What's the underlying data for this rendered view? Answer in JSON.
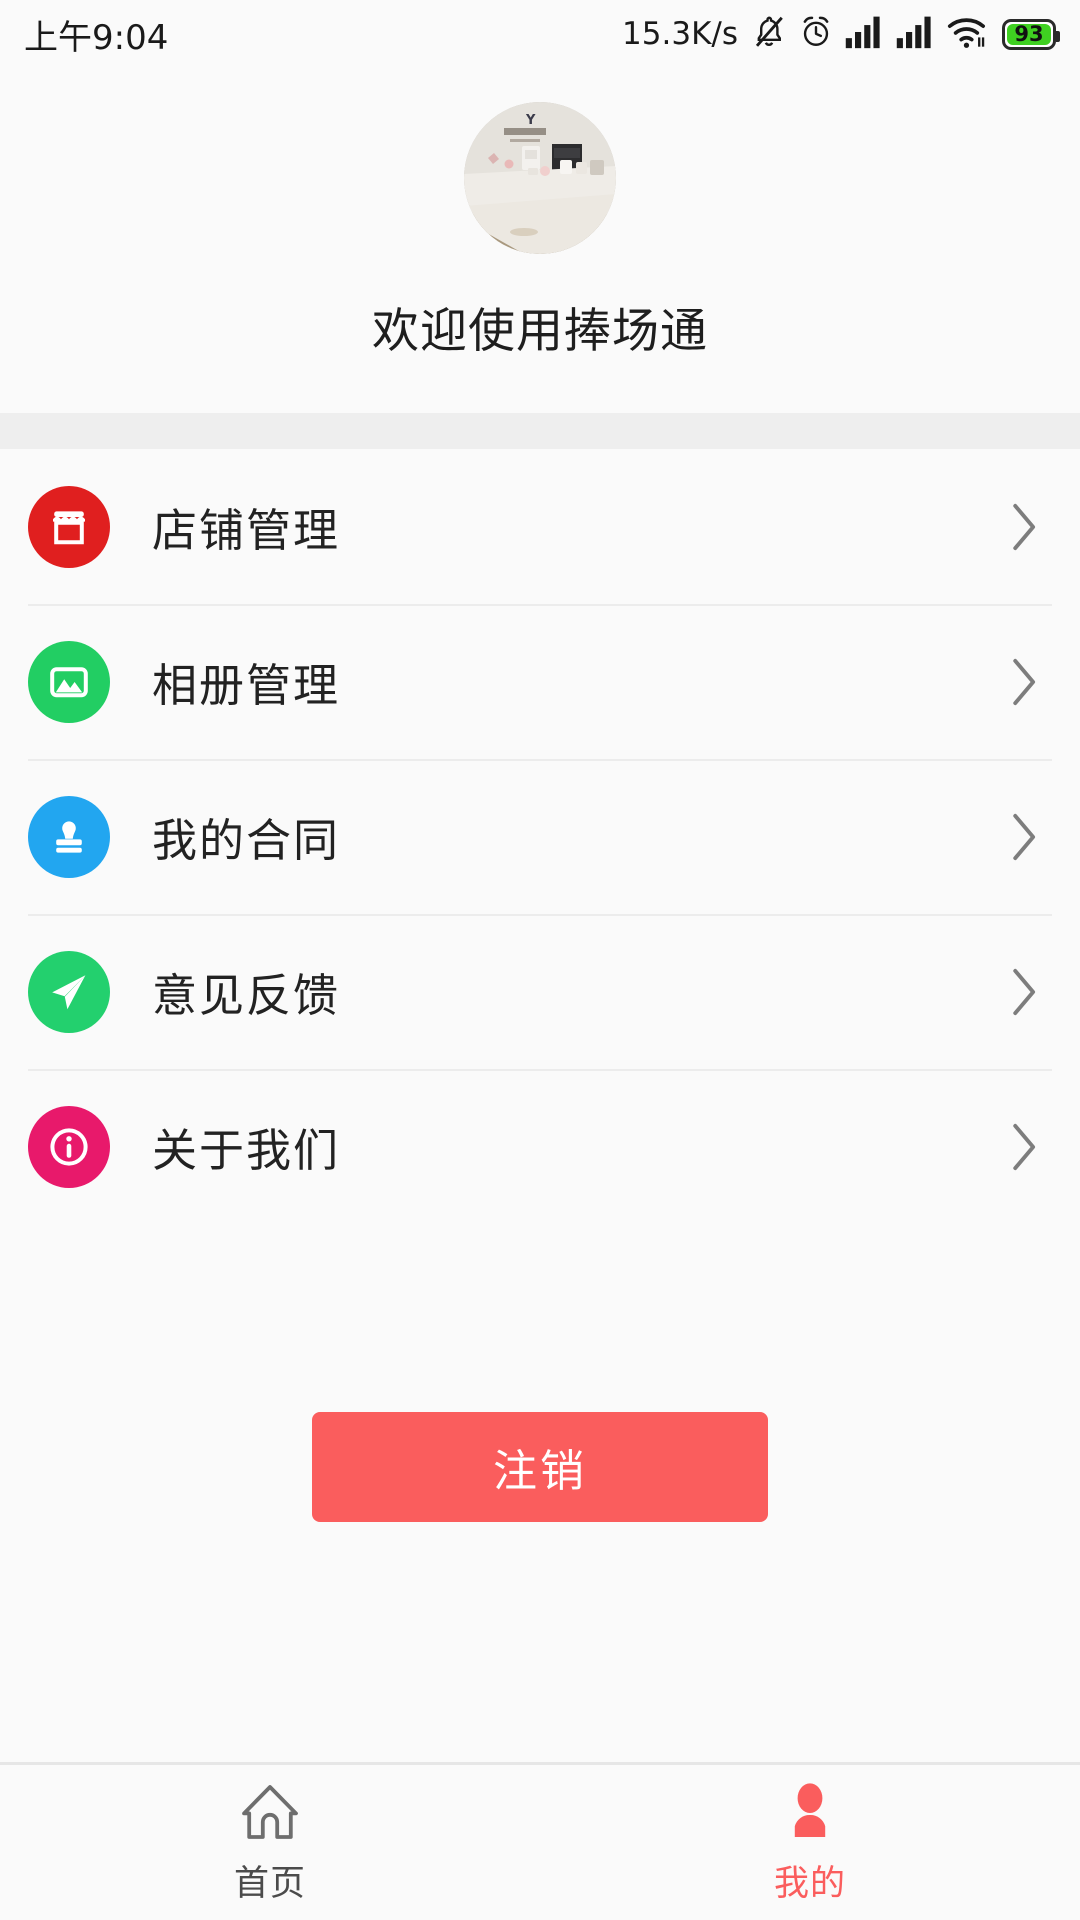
{
  "status_bar": {
    "time": "上午9:04",
    "net_speed": "15.3K/s",
    "battery_level": "93",
    "icons": [
      "bell-muted-icon",
      "alarm-clock-icon",
      "signal-bars-icon",
      "signal-bars-icon",
      "wifi-icon",
      "battery-icon"
    ]
  },
  "profile": {
    "avatar_alt": "店铺照片",
    "welcome_text": "欢迎使用捧场通"
  },
  "menu": {
    "items": [
      {
        "label": "店铺管理",
        "icon": "store-icon",
        "color": "#e01f1f"
      },
      {
        "label": "相册管理",
        "icon": "photo-icon",
        "color": "#22ce63"
      },
      {
        "label": "我的合同",
        "icon": "stamp-icon",
        "color": "#22a6f0"
      },
      {
        "label": "意见反馈",
        "icon": "send-icon",
        "color": "#23d06e"
      },
      {
        "label": "关于我们",
        "icon": "info-icon",
        "color": "#e8196b"
      }
    ],
    "chevron_icon": "chevron-right-icon"
  },
  "logout": {
    "label": "注销",
    "color": "#fa5d5d"
  },
  "tabbar": {
    "tabs": [
      {
        "label": "首页",
        "icon": "home-icon",
        "active": false
      },
      {
        "label": "我的",
        "icon": "person-icon",
        "active": true
      }
    ],
    "active_color": "#fa5d5d",
    "inactive_color": "#4b4b4b"
  }
}
